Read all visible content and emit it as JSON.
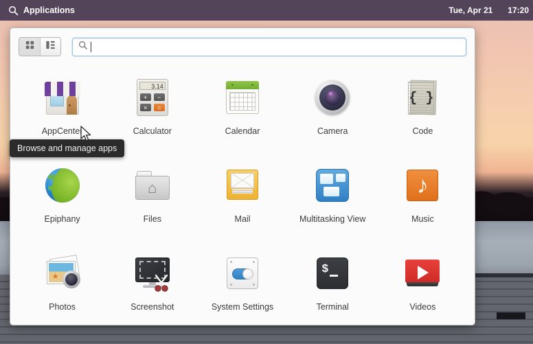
{
  "panel": {
    "search_icon": "search-icon",
    "applications_label": "Applications",
    "date": "Tue, Apr 21",
    "time": "17:20"
  },
  "popover": {
    "view_switcher": {
      "grid_view": {
        "icon": "grid-view-icon",
        "active": true
      },
      "category_view": {
        "icon": "category-view-icon",
        "active": false
      }
    },
    "search": {
      "icon": "search-icon",
      "value": "",
      "placeholder": ""
    },
    "apps": [
      {
        "name": "AppCenter",
        "icon": "appcenter-icon"
      },
      {
        "name": "Calculator",
        "icon": "calculator-icon",
        "display": "3.14",
        "keys": [
          "+",
          "−",
          "×",
          "="
        ]
      },
      {
        "name": "Calendar",
        "icon": "calendar-icon"
      },
      {
        "name": "Camera",
        "icon": "camera-icon"
      },
      {
        "name": "Code",
        "icon": "code-icon",
        "glyph": "{ }"
      },
      {
        "name": "Epiphany",
        "icon": "epiphany-icon"
      },
      {
        "name": "Files",
        "icon": "files-icon",
        "glyph": "⌂"
      },
      {
        "name": "Mail",
        "icon": "mail-icon"
      },
      {
        "name": "Multitasking View",
        "icon": "multitasking-view-icon"
      },
      {
        "name": "Music",
        "icon": "music-icon",
        "glyph": "♪"
      },
      {
        "name": "Photos",
        "icon": "photos-icon",
        "glyph": "★"
      },
      {
        "name": "Screenshot",
        "icon": "screenshot-icon"
      },
      {
        "name": "System Settings",
        "icon": "system-settings-icon"
      },
      {
        "name": "Terminal",
        "icon": "terminal-icon",
        "glyph": "$"
      },
      {
        "name": "Videos",
        "icon": "videos-icon"
      }
    ]
  },
  "tooltip": {
    "text": "Browse and manage apps"
  },
  "colors": {
    "panel_bg": "#463952",
    "popover_bg": "#fbfbfb",
    "search_border": "#9ec5d8",
    "tooltip_bg": "#2b2b2b",
    "label_text": "#3b3b3b"
  }
}
